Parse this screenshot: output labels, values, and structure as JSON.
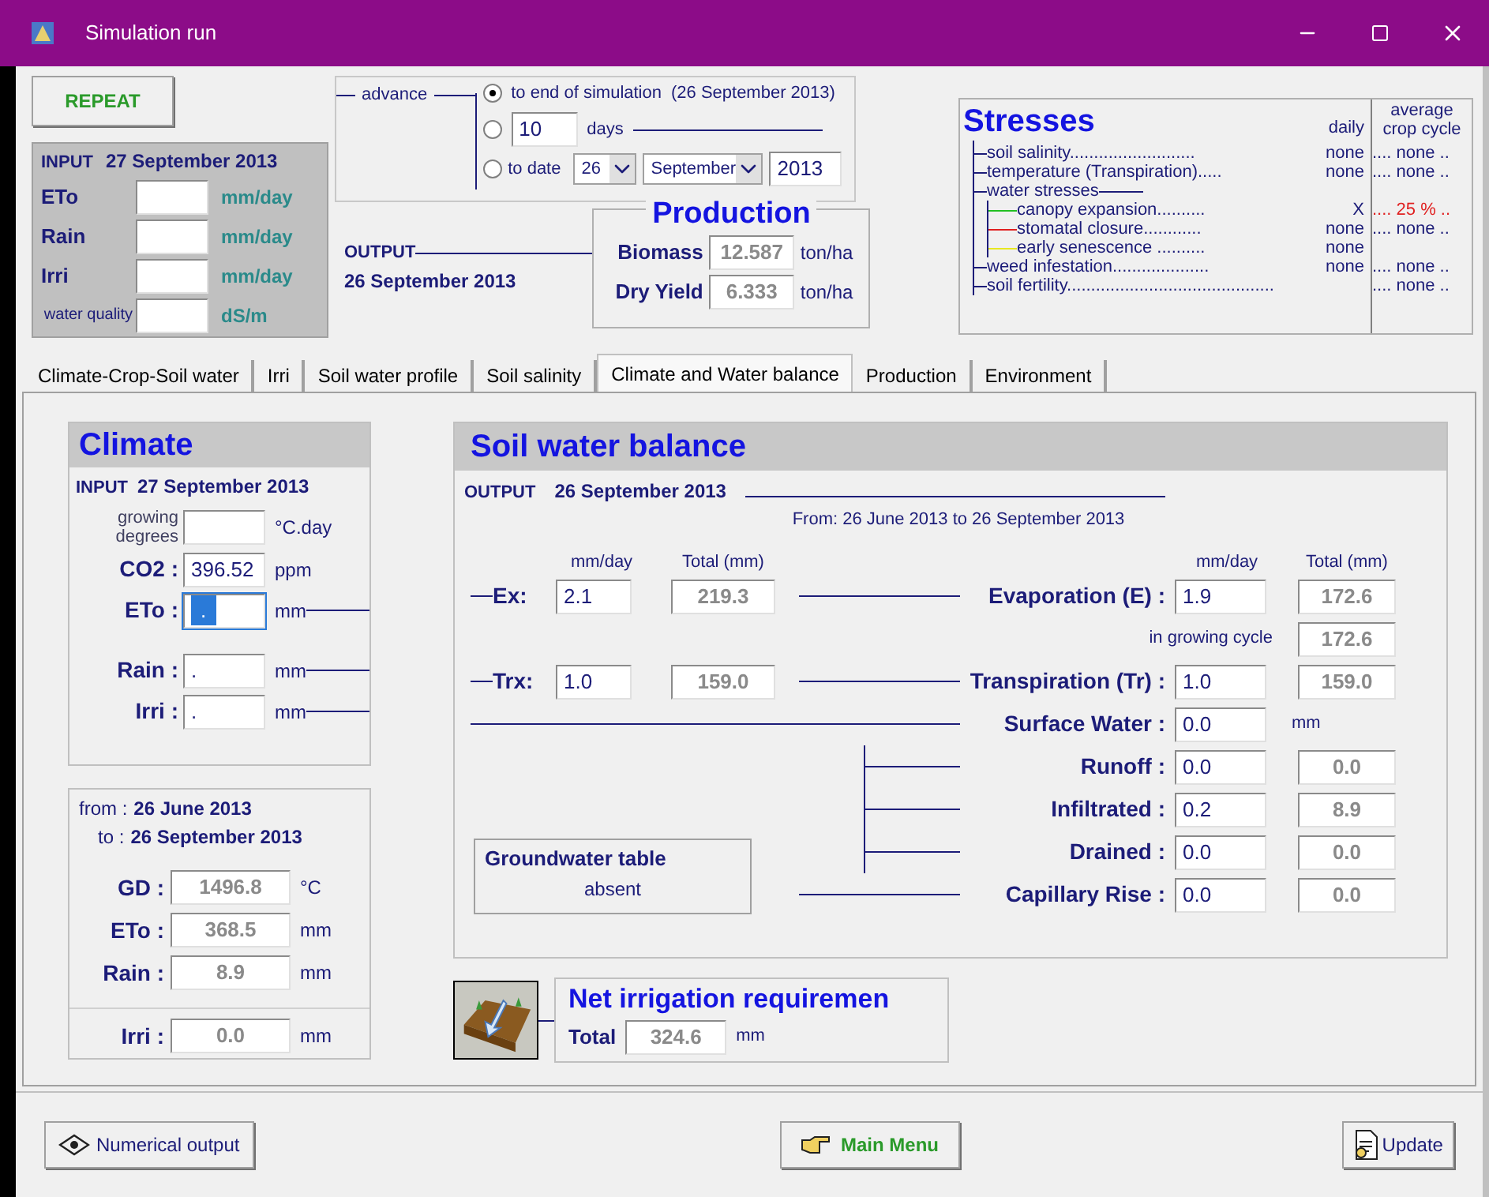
{
  "window": {
    "title": "Simulation run"
  },
  "repeat_button": "REPEAT",
  "advance": {
    "label": "advance",
    "options": [
      {
        "kind": "end",
        "label": "to end of simulation",
        "note": "(26 September 2013)",
        "selected": true
      },
      {
        "kind": "days",
        "value": "10",
        "label": "days",
        "selected": false
      },
      {
        "kind": "date",
        "label": "to date",
        "day": "26",
        "month": "September",
        "year": "2013",
        "selected": false
      }
    ]
  },
  "input": {
    "label": "INPUT",
    "date": "27 September 2013",
    "fields": [
      {
        "kind": "big",
        "label": "ETo",
        "unit": "mm/day"
      },
      {
        "kind": "big",
        "label": "Rain",
        "unit": "mm/day"
      },
      {
        "kind": "big",
        "label": "Irri",
        "unit": "mm/day"
      },
      {
        "kind": "small",
        "label": "water quality",
        "unit": "dS/m"
      }
    ]
  },
  "output": {
    "label": "OUTPUT",
    "date": "26 September 2013"
  },
  "production": {
    "title": "Production",
    "rows": [
      {
        "label": "Biomass",
        "value": "12.587",
        "unit": "ton/ha"
      },
      {
        "label": "Dry Yield",
        "value": "6.333",
        "unit": "ton/ha"
      }
    ]
  },
  "stresses": {
    "title": "Stresses",
    "daily_header": "daily",
    "average_header": "average crop cycle",
    "rows": [
      {
        "label": "soil salinity..........................",
        "daily": "none",
        "average": ".... none ..",
        "alert": false
      },
      {
        "label": "temperature (Transpiration).....",
        "daily": "none",
        "average": ".... none ..",
        "alert": false
      },
      {
        "label": "water stresses",
        "children": [
          {
            "label": "canopy expansion..........",
            "daily": "X",
            "average": ".... 25 % ..",
            "alert": true,
            "color": "#22c022"
          },
          {
            "label": "stomatal closure............",
            "daily": "none",
            "average": ".... none ..",
            "alert": false,
            "color": "#e02020"
          },
          {
            "label": "early senescence ..........",
            "daily": "none",
            "color": "#e8e820"
          }
        ]
      },
      {
        "label": "weed infestation....................",
        "daily": "none",
        "average": ".... none ..",
        "alert": false
      },
      {
        "label": "soil fertility...........................................",
        "average": ".... none ..",
        "alert": false
      }
    ]
  },
  "tabs": [
    {
      "label": "Climate-Crop-Soil water",
      "selected": false
    },
    {
      "label": "Irri",
      "selected": false
    },
    {
      "label": "Soil water profile",
      "selected": false
    },
    {
      "label": "Soil salinity",
      "selected": false
    },
    {
      "label": "Climate and Water balance",
      "selected": true
    },
    {
      "label": "Production",
      "selected": false
    },
    {
      "label": "Environment",
      "selected": false
    }
  ],
  "climate": {
    "title": "Climate",
    "input_label": "INPUT",
    "date": "27 September 2013",
    "fields": [
      {
        "kind": "small",
        "label": "growing degrees",
        "unit": "°C.day",
        "focused": false
      },
      {
        "kind": "big",
        "label": "CO2 :",
        "value": "396.52",
        "unit": "ppm",
        "focused": false
      },
      {
        "kind": "big",
        "label": "ETo :",
        "value": ".",
        "unit": "mm",
        "focused": true
      },
      {
        "kind": "big",
        "label": "Rain :",
        "value": ".",
        "unit": "mm",
        "focused": false
      },
      {
        "kind": "big",
        "label": "Irri :",
        "value": ".",
        "unit": "mm",
        "focused": false
      }
    ]
  },
  "period": {
    "from_label": "from :",
    "from": "26 June 2013",
    "to_label": "to :",
    "to": "26 September 2013",
    "fields": [
      {
        "label": "GD :",
        "value": "1496.8",
        "unit": "°C"
      },
      {
        "label": "ETo :",
        "value": "368.5",
        "unit": "mm"
      },
      {
        "label": "Rain :",
        "value": "8.9",
        "unit": "mm"
      },
      {
        "label": "Irri :",
        "value": "0.0",
        "unit": "mm"
      }
    ]
  },
  "soil_water_balance": {
    "title": "Soil water balance",
    "output_label": "OUTPUT",
    "date": "26 September 2013",
    "period": "From: 26 June 2013  to 26 September 2013",
    "left_headers": [
      "mm/day",
      "Total (mm)"
    ],
    "right_headers": [
      "mm/day",
      "Total (mm)"
    ],
    "crop": [
      {
        "label": "Ex:",
        "daily": "2.1",
        "total": "219.3"
      },
      {
        "label": "Trx:",
        "daily": "1.0",
        "total": "159.0"
      }
    ],
    "evaporation": {
      "label": "Evaporation (E) :",
      "daily": "1.9",
      "total": "172.6"
    },
    "growing_cycle": {
      "label": "in growing cycle",
      "total": "172.6"
    },
    "transpiration": {
      "label": "Transpiration (Tr) :",
      "daily": "1.0",
      "total": "159.0"
    },
    "surface_water": {
      "label": "Surface Water :",
      "daily": "0.0",
      "unit": "mm"
    },
    "flows": [
      {
        "label": "Runoff :",
        "daily": "0.0",
        "total": "0.0"
      },
      {
        "label": "Infiltrated :",
        "daily": "0.2",
        "total": "8.9"
      },
      {
        "label": "Drained :",
        "daily": "0.0",
        "total": "0.0"
      }
    ],
    "groundwater": {
      "title": "Groundwater table",
      "value": "absent"
    },
    "capillary": {
      "label": "Capillary Rise :",
      "daily": "0.0",
      "total": "0.0"
    }
  },
  "net_irrigation": {
    "title": "Net irrigation requiremen",
    "label": "Total",
    "value": "324.6",
    "unit": "mm"
  },
  "buttons": [
    "Numerical output",
    "Main Menu",
    "Update"
  ]
}
